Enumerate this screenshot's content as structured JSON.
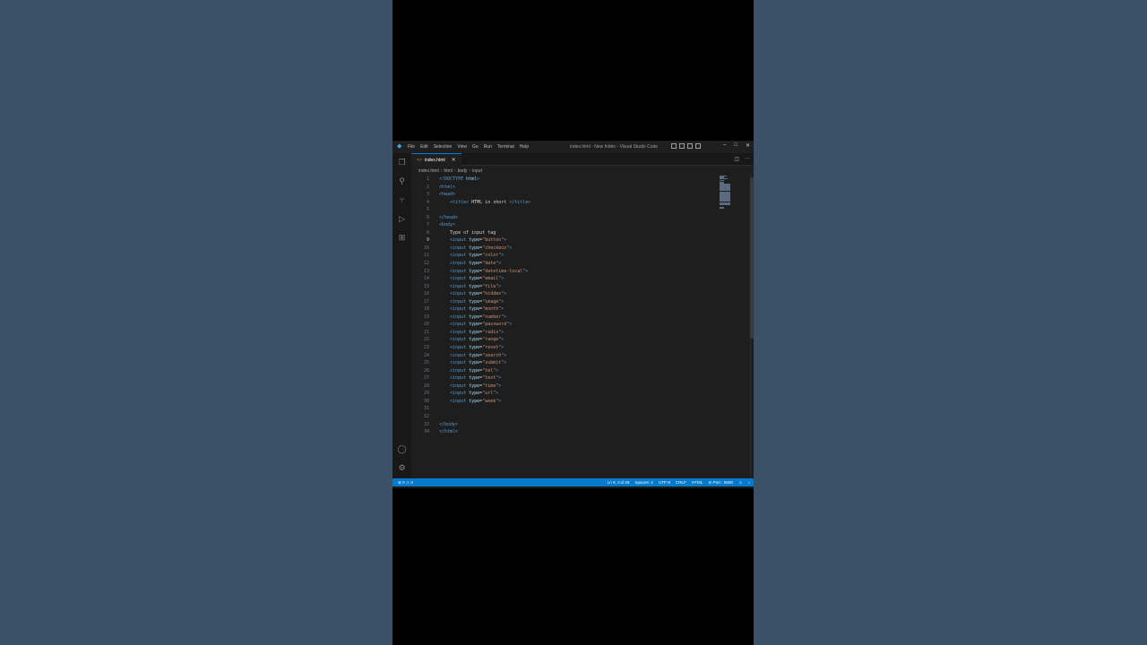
{
  "window": {
    "menus": [
      "File",
      "Edit",
      "Selection",
      "View",
      "Go",
      "Run",
      "Terminal",
      "Help"
    ],
    "title": "index.html - New folder - Visual Studio Code"
  },
  "tab": {
    "label": "index.html"
  },
  "breadcrumb": [
    "index.html",
    "html",
    "body",
    "input"
  ],
  "code_lines": [
    {
      "n": "1",
      "tokens": [
        {
          "c": "tag",
          "t": "<!DOCTYPE "
        },
        {
          "c": "attr",
          "t": "html"
        },
        {
          "c": "tag",
          "t": ">"
        }
      ]
    },
    {
      "n": "2",
      "tokens": [
        {
          "c": "tag",
          "t": "<html>"
        }
      ]
    },
    {
      "n": "3",
      "tokens": [
        {
          "c": "tag",
          "t": "<head>"
        }
      ]
    },
    {
      "n": "4",
      "tokens": [
        {
          "c": "plain",
          "t": "    "
        },
        {
          "c": "tag",
          "t": "<title>"
        },
        {
          "c": "plain",
          "t": " HTML in short "
        },
        {
          "c": "tag",
          "t": "</title>"
        }
      ]
    },
    {
      "n": "5",
      "tokens": []
    },
    {
      "n": "6",
      "tokens": [
        {
          "c": "tag",
          "t": "</head>"
        }
      ]
    },
    {
      "n": "7",
      "tokens": [
        {
          "c": "tag",
          "t": "<body>"
        }
      ]
    },
    {
      "n": "8",
      "tokens": [
        {
          "c": "plain",
          "t": "    Type of input tag"
        }
      ]
    },
    {
      "n": "9",
      "tokens": [
        {
          "c": "plain",
          "t": "    "
        },
        {
          "c": "tag",
          "t": "<input "
        },
        {
          "c": "attr",
          "t": "type"
        },
        {
          "c": "plain",
          "t": "="
        },
        {
          "c": "str",
          "t": "\"button\""
        },
        {
          "c": "tag",
          "t": ">"
        }
      ]
    },
    {
      "n": "10",
      "tokens": [
        {
          "c": "plain",
          "t": "    "
        },
        {
          "c": "tag",
          "t": "<input "
        },
        {
          "c": "attr",
          "t": "type"
        },
        {
          "c": "plain",
          "t": "="
        },
        {
          "c": "str",
          "t": "\"checkbox\""
        },
        {
          "c": "tag",
          "t": ">"
        }
      ]
    },
    {
      "n": "11",
      "tokens": [
        {
          "c": "plain",
          "t": "    "
        },
        {
          "c": "tag",
          "t": "<input "
        },
        {
          "c": "attr",
          "t": "type"
        },
        {
          "c": "plain",
          "t": "="
        },
        {
          "c": "str",
          "t": "\"color\""
        },
        {
          "c": "tag",
          "t": ">"
        }
      ]
    },
    {
      "n": "12",
      "tokens": [
        {
          "c": "plain",
          "t": "    "
        },
        {
          "c": "tag",
          "t": "<input "
        },
        {
          "c": "attr",
          "t": "type"
        },
        {
          "c": "plain",
          "t": "="
        },
        {
          "c": "str",
          "t": "\"date\""
        },
        {
          "c": "tag",
          "t": ">"
        }
      ]
    },
    {
      "n": "13",
      "tokens": [
        {
          "c": "plain",
          "t": "    "
        },
        {
          "c": "tag",
          "t": "<input "
        },
        {
          "c": "attr",
          "t": "type"
        },
        {
          "c": "plain",
          "t": "="
        },
        {
          "c": "str",
          "t": "\"datetime-local\""
        },
        {
          "c": "tag",
          "t": ">"
        }
      ]
    },
    {
      "n": "14",
      "tokens": [
        {
          "c": "plain",
          "t": "    "
        },
        {
          "c": "tag",
          "t": "<input "
        },
        {
          "c": "attr",
          "t": "type"
        },
        {
          "c": "plain",
          "t": "="
        },
        {
          "c": "str",
          "t": "\"email\""
        },
        {
          "c": "tag",
          "t": ">"
        }
      ]
    },
    {
      "n": "15",
      "tokens": [
        {
          "c": "plain",
          "t": "    "
        },
        {
          "c": "tag",
          "t": "<input "
        },
        {
          "c": "attr",
          "t": "type"
        },
        {
          "c": "plain",
          "t": "="
        },
        {
          "c": "str",
          "t": "\"file\""
        },
        {
          "c": "tag",
          "t": ">"
        }
      ]
    },
    {
      "n": "16",
      "tokens": [
        {
          "c": "plain",
          "t": "    "
        },
        {
          "c": "tag",
          "t": "<input "
        },
        {
          "c": "attr",
          "t": "type"
        },
        {
          "c": "plain",
          "t": "="
        },
        {
          "c": "str",
          "t": "\"hidden\""
        },
        {
          "c": "tag",
          "t": ">"
        }
      ]
    },
    {
      "n": "17",
      "tokens": [
        {
          "c": "plain",
          "t": "    "
        },
        {
          "c": "tag",
          "t": "<input "
        },
        {
          "c": "attr",
          "t": "type"
        },
        {
          "c": "plain",
          "t": "="
        },
        {
          "c": "str",
          "t": "\"image\""
        },
        {
          "c": "tag",
          "t": ">"
        }
      ]
    },
    {
      "n": "18",
      "tokens": [
        {
          "c": "plain",
          "t": "    "
        },
        {
          "c": "tag",
          "t": "<input "
        },
        {
          "c": "attr",
          "t": "type"
        },
        {
          "c": "plain",
          "t": "="
        },
        {
          "c": "str",
          "t": "\"month\""
        },
        {
          "c": "tag",
          "t": ">"
        }
      ]
    },
    {
      "n": "19",
      "tokens": [
        {
          "c": "plain",
          "t": "    "
        },
        {
          "c": "tag",
          "t": "<input "
        },
        {
          "c": "attr",
          "t": "type"
        },
        {
          "c": "plain",
          "t": "="
        },
        {
          "c": "str",
          "t": "\"number\""
        },
        {
          "c": "tag",
          "t": ">"
        }
      ]
    },
    {
      "n": "20",
      "tokens": [
        {
          "c": "plain",
          "t": "    "
        },
        {
          "c": "tag",
          "t": "<input "
        },
        {
          "c": "attr",
          "t": "type"
        },
        {
          "c": "plain",
          "t": "="
        },
        {
          "c": "str",
          "t": "\"password\""
        },
        {
          "c": "tag",
          "t": ">"
        }
      ]
    },
    {
      "n": "21",
      "tokens": [
        {
          "c": "plain",
          "t": "    "
        },
        {
          "c": "tag",
          "t": "<input "
        },
        {
          "c": "attr",
          "t": "type"
        },
        {
          "c": "plain",
          "t": "="
        },
        {
          "c": "str",
          "t": "\"radio\""
        },
        {
          "c": "tag",
          "t": ">"
        }
      ]
    },
    {
      "n": "22",
      "tokens": [
        {
          "c": "plain",
          "t": "    "
        },
        {
          "c": "tag",
          "t": "<input "
        },
        {
          "c": "attr",
          "t": "type"
        },
        {
          "c": "plain",
          "t": "="
        },
        {
          "c": "str",
          "t": "\"range\""
        },
        {
          "c": "tag",
          "t": ">"
        }
      ]
    },
    {
      "n": "23",
      "tokens": [
        {
          "c": "plain",
          "t": "    "
        },
        {
          "c": "tag",
          "t": "<input "
        },
        {
          "c": "attr",
          "t": "type"
        },
        {
          "c": "plain",
          "t": "="
        },
        {
          "c": "str",
          "t": "\"reset\""
        },
        {
          "c": "tag",
          "t": ">"
        }
      ]
    },
    {
      "n": "24",
      "tokens": [
        {
          "c": "plain",
          "t": "    "
        },
        {
          "c": "tag",
          "t": "<input "
        },
        {
          "c": "attr",
          "t": "type"
        },
        {
          "c": "plain",
          "t": "="
        },
        {
          "c": "str",
          "t": "\"search\""
        },
        {
          "c": "tag",
          "t": ">"
        }
      ]
    },
    {
      "n": "25",
      "tokens": [
        {
          "c": "plain",
          "t": "    "
        },
        {
          "c": "tag",
          "t": "<input "
        },
        {
          "c": "attr",
          "t": "type"
        },
        {
          "c": "plain",
          "t": "="
        },
        {
          "c": "str",
          "t": "\"submit\""
        },
        {
          "c": "tag",
          "t": ">"
        }
      ]
    },
    {
      "n": "26",
      "tokens": [
        {
          "c": "plain",
          "t": "    "
        },
        {
          "c": "tag",
          "t": "<input "
        },
        {
          "c": "attr",
          "t": "type"
        },
        {
          "c": "plain",
          "t": "="
        },
        {
          "c": "str",
          "t": "\"tel\""
        },
        {
          "c": "tag",
          "t": ">"
        }
      ]
    },
    {
      "n": "27",
      "tokens": [
        {
          "c": "plain",
          "t": "    "
        },
        {
          "c": "tag",
          "t": "<input "
        },
        {
          "c": "attr",
          "t": "type"
        },
        {
          "c": "plain",
          "t": "="
        },
        {
          "c": "str",
          "t": "\"text\""
        },
        {
          "c": "tag",
          "t": ">"
        }
      ]
    },
    {
      "n": "28",
      "tokens": [
        {
          "c": "plain",
          "t": "    "
        },
        {
          "c": "tag",
          "t": "<input "
        },
        {
          "c": "attr",
          "t": "type"
        },
        {
          "c": "plain",
          "t": "="
        },
        {
          "c": "str",
          "t": "\"time\""
        },
        {
          "c": "tag",
          "t": ">"
        }
      ]
    },
    {
      "n": "29",
      "tokens": [
        {
          "c": "plain",
          "t": "    "
        },
        {
          "c": "tag",
          "t": "<input "
        },
        {
          "c": "attr",
          "t": "type"
        },
        {
          "c": "plain",
          "t": "="
        },
        {
          "c": "str",
          "t": "\"url\""
        },
        {
          "c": "tag",
          "t": ">"
        }
      ]
    },
    {
      "n": "30",
      "tokens": [
        {
          "c": "plain",
          "t": "    "
        },
        {
          "c": "tag",
          "t": "<input "
        },
        {
          "c": "attr",
          "t": "type"
        },
        {
          "c": "plain",
          "t": "="
        },
        {
          "c": "str",
          "t": "\"week\""
        },
        {
          "c": "tag",
          "t": ">"
        }
      ]
    },
    {
      "n": "31",
      "tokens": []
    },
    {
      "n": "32",
      "tokens": []
    },
    {
      "n": "33",
      "tokens": [
        {
          "c": "tag",
          "t": "</body>"
        }
      ]
    },
    {
      "n": "34",
      "tokens": [
        {
          "c": "tag",
          "t": "</html>"
        }
      ]
    }
  ],
  "current_line": "9",
  "status": {
    "problems": "⊗ 0 ⚠ 0",
    "items": [
      "Ln 9, Col 26",
      "Spaces: 4",
      "UTF-8",
      "CRLF",
      "HTML",
      "⊘ Port : 5500"
    ]
  },
  "colors": {
    "accent": "#007acc",
    "editor_bg": "#1e1e1e",
    "page_bg": "#3b5168"
  },
  "icons": {
    "activity": [
      "explorer-icon",
      "search-icon",
      "source-control-icon",
      "run-debug-icon",
      "extensions-icon"
    ],
    "activity_bottom": [
      "account-icon",
      "settings-gear-icon"
    ],
    "taskbar": [
      "windows-start-icon",
      "search-icon",
      "file-explorer-icon",
      "widgets-icon",
      "chat-icon",
      "folder-icon",
      "edge-icon",
      "store-icon",
      "app-icon",
      "app-icon",
      "app-icon",
      "photoshop-icon",
      "chrome-icon",
      "acrobat-icon",
      "media-encoder-icon",
      "after-effects-icon",
      "premiere-icon",
      "chrome-icon",
      "app-icon",
      "vscode-icon",
      "chrome-icon"
    ]
  }
}
